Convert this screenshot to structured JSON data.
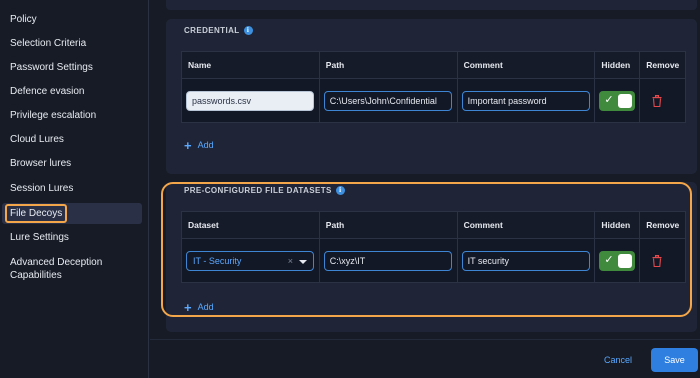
{
  "sidebar": {
    "items": [
      {
        "label": "Policy"
      },
      {
        "label": "Selection Criteria"
      },
      {
        "label": "Password Settings"
      },
      {
        "label": "Defence evasion"
      },
      {
        "label": "Privilege escalation"
      },
      {
        "label": "Cloud Lures"
      },
      {
        "label": "Browser lures"
      },
      {
        "label": "Session Lures"
      },
      {
        "label": "File Decoys",
        "active": true
      },
      {
        "label": "Lure Settings"
      },
      {
        "label": "Advanced Deception Capabilities"
      }
    ]
  },
  "credential": {
    "title": "CREDENTIAL",
    "columns": [
      "Name",
      "Path",
      "Comment",
      "Hidden",
      "Remove"
    ],
    "rows": [
      {
        "name": "passwords.csv",
        "path": "C:\\Users\\John\\Confidential",
        "comment": "Important password",
        "hidden": true
      }
    ],
    "add_label": "Add"
  },
  "datasets": {
    "title": "PRE-CONFIGURED FILE DATASETS",
    "columns": [
      "Dataset",
      "Path",
      "Comment",
      "Hidden",
      "Remove"
    ],
    "rows": [
      {
        "dataset": "IT - Security",
        "path": "C:\\xyz\\IT",
        "comment": "IT security",
        "hidden": true
      }
    ],
    "add_label": "Add",
    "clear_glyph": "×"
  },
  "footer": {
    "cancel_label": "Cancel",
    "save_label": "Save"
  },
  "colors": {
    "accent": "#2f7fe0",
    "link": "#5aa8ff",
    "highlight": "#f3a64a",
    "toggle_on": "#3f8a3c",
    "danger": "#e5484d"
  },
  "icons": {
    "info": "info-icon",
    "plus": "plus-icon",
    "trash": "trash-icon",
    "check": "check-icon",
    "caret": "chevron-down-icon",
    "clear": "clear-icon"
  }
}
